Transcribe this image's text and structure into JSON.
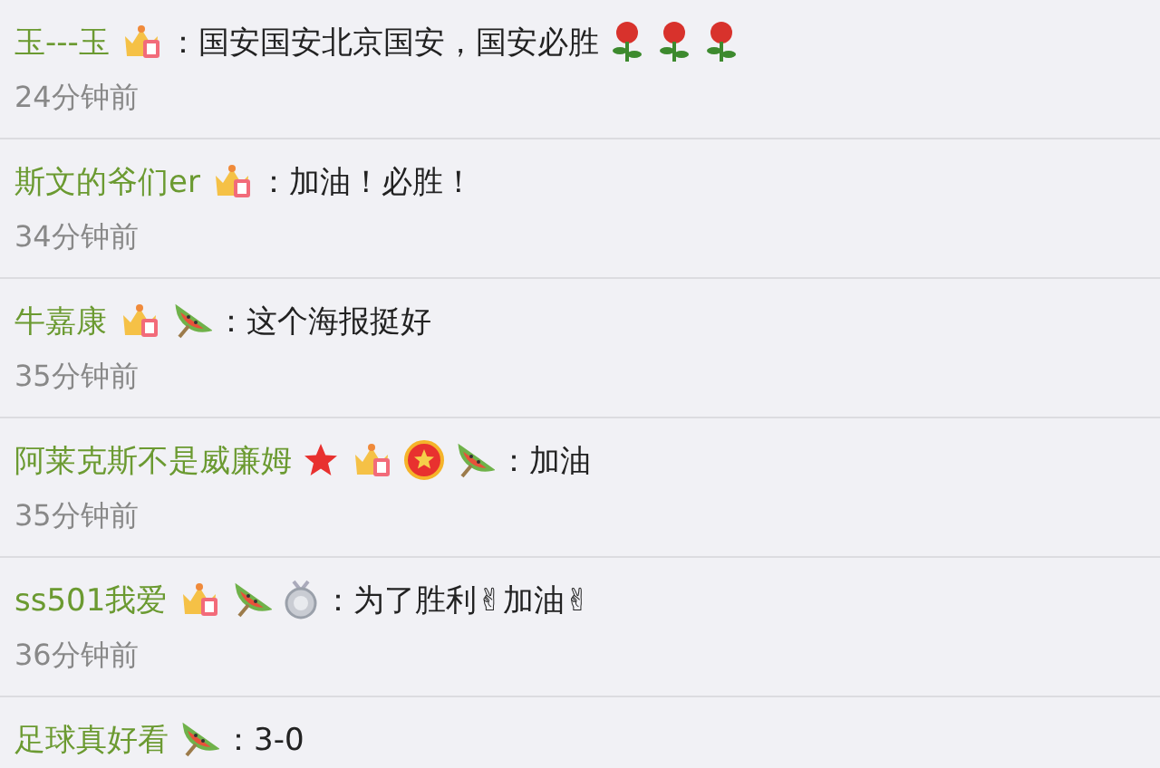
{
  "comments": [
    {
      "user": "玉---玉",
      "badges": [
        {
          "kind": "crown"
        }
      ],
      "text": "：国安国安北京国安，国安必胜",
      "trailing": [
        {
          "kind": "rose"
        },
        {
          "kind": "rose"
        },
        {
          "kind": "rose"
        }
      ],
      "time": "24分钟前"
    },
    {
      "user": "斯文的爷们er",
      "badges": [
        {
          "kind": "crown"
        }
      ],
      "text": "：加油！必胜！",
      "time": "34分钟前"
    },
    {
      "user": "牛嘉康",
      "badges": [
        {
          "kind": "crown"
        },
        {
          "kind": "watermelon"
        }
      ],
      "text": "：这个海报挺好",
      "time": "35分钟前"
    },
    {
      "user": "阿莱克斯不是威廉姆",
      "badges": [
        {
          "kind": "star"
        },
        {
          "kind": "crown"
        },
        {
          "kind": "medal"
        },
        {
          "kind": "watermelon"
        }
      ],
      "text": "：加油",
      "time": "35分钟前"
    },
    {
      "user": "ss501我爱",
      "badges": [
        {
          "kind": "crown"
        },
        {
          "kind": "watermelon"
        },
        {
          "kind": "silver"
        }
      ],
      "text": "：为了胜利✌加油✌",
      "time": "36分钟前"
    },
    {
      "user": "足球真好看",
      "badges": [
        {
          "kind": "watermelon"
        }
      ],
      "text": "：3-0"
    }
  ]
}
